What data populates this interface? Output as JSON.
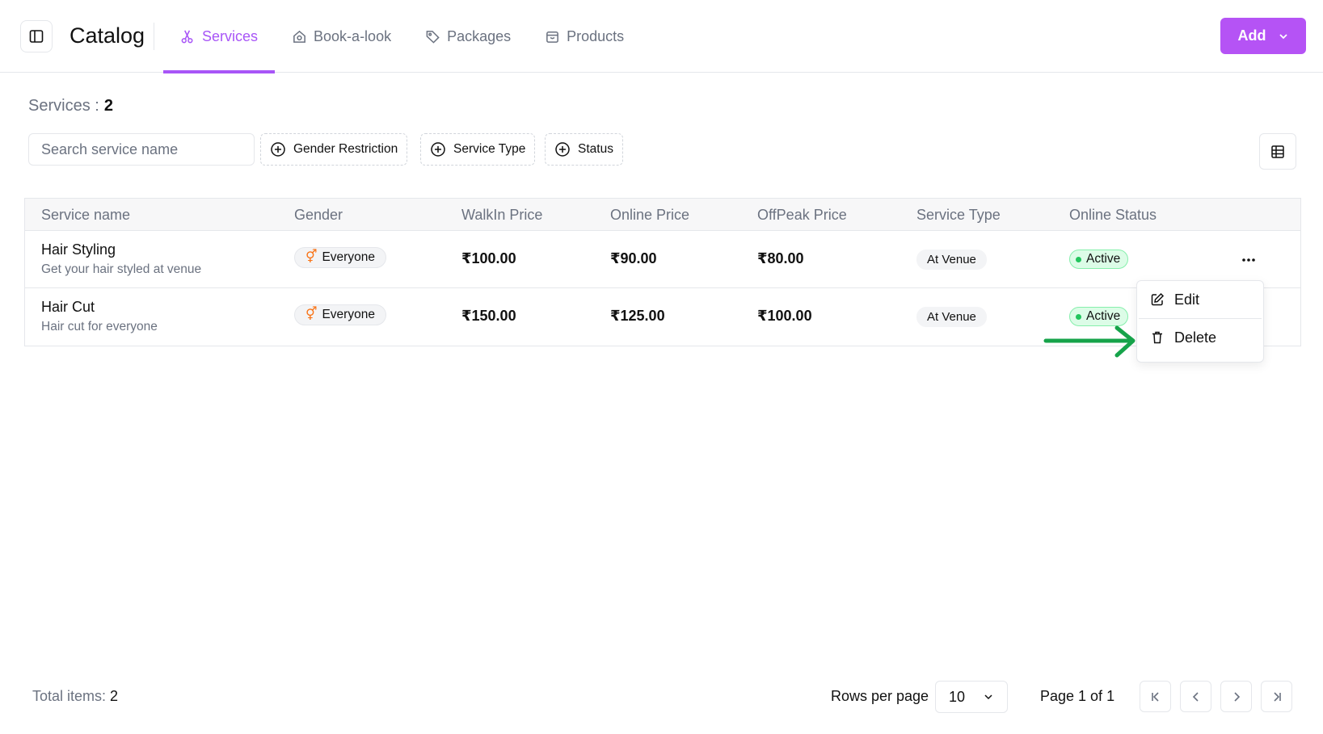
{
  "header": {
    "title": "Catalog",
    "tabs": [
      {
        "label": "Services",
        "icon": "scissors-icon",
        "active": true
      },
      {
        "label": "Book-a-look",
        "icon": "house-icon",
        "active": false
      },
      {
        "label": "Packages",
        "icon": "tag-icon",
        "active": false
      },
      {
        "label": "Products",
        "icon": "package-icon",
        "active": false
      }
    ],
    "add_label": "Add"
  },
  "summary": {
    "label": "Services :",
    "count": "2"
  },
  "filters": {
    "search_placeholder": "Search service name",
    "gender": "Gender Restriction",
    "service_type": "Service Type",
    "status": "Status"
  },
  "table": {
    "columns": [
      "Service name",
      "Gender",
      "WalkIn Price",
      "Online Price",
      "OffPeak Price",
      "Service Type",
      "Online Status"
    ],
    "rows": [
      {
        "name": "Hair Styling",
        "description": "Get your hair styled at venue",
        "gender": "Everyone",
        "walkin": "₹100.00",
        "online": "₹90.00",
        "offpeak": "₹80.00",
        "type": "At Venue",
        "status": "Active"
      },
      {
        "name": "Hair Cut",
        "description": "Hair cut for everyone",
        "gender": "Everyone",
        "walkin": "₹150.00",
        "online": "₹125.00",
        "offpeak": "₹100.00",
        "type": "At Venue",
        "status": "Active"
      }
    ]
  },
  "row_menu": {
    "edit": "Edit",
    "delete": "Delete"
  },
  "footer": {
    "total_label": "Total items:",
    "total_count": "2",
    "rows_per_page_label": "Rows per page",
    "rows_per_page_value": "10",
    "page_label": "Page 1 of 1"
  },
  "colors": {
    "accent": "#a855f7",
    "add_button": "#b553f5",
    "status_active": "#22c55e",
    "gender_icon": "#f97316",
    "annotation_arrow": "#16a34a"
  }
}
